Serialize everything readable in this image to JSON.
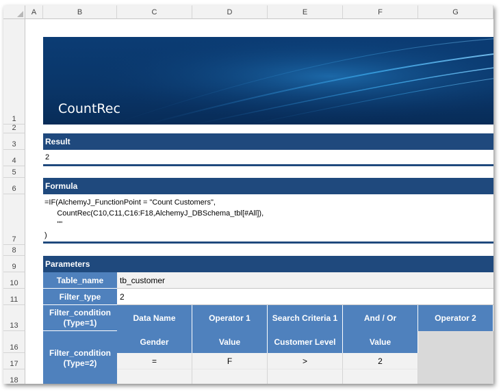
{
  "columns": [
    "A",
    "B",
    "C",
    "D",
    "E",
    "F",
    "G"
  ],
  "rows": [
    "1",
    "2",
    "3",
    "4",
    "5",
    "6",
    "7",
    "8",
    "9",
    "10",
    "11",
    "13",
    "16",
    "17",
    "18"
  ],
  "banner": {
    "title": "CountRec"
  },
  "result": {
    "header": "Result",
    "value": "2"
  },
  "formula": {
    "header": "Formula",
    "lines": [
      "=IF(AlchemyJ_FunctionPoint = \"Count Customers\",",
      "      CountRec(C10,C11,C16:F18,AlchemyJ_DBSchema_tbl[#All]),",
      "      \"\"",
      ")"
    ]
  },
  "parameters": {
    "header": "Parameters",
    "table_name_label": "Table_name",
    "table_name_value": "tb_customer",
    "filter_type_label": "Filter_type",
    "filter_type_value": "2",
    "filter_condition_1_label": "Filter_condition (Type=1)",
    "filter_condition_1_headers": [
      "Data Name",
      "Operator 1",
      "Search Criteria 1",
      "And / Or",
      "Operator 2"
    ],
    "filter_condition_2_label": "Filter_condition (Type=2)",
    "filter_condition_2_headers": [
      "Gender",
      "Value",
      "Customer Level",
      "Value"
    ],
    "filter_condition_2_row1": [
      "=",
      "F",
      ">",
      "2"
    ]
  },
  "colors": {
    "header_dark": "#1f497d",
    "header_light": "#4f81bd",
    "value_bg": "#f2f2f2",
    "banner": "#0b3c74"
  }
}
